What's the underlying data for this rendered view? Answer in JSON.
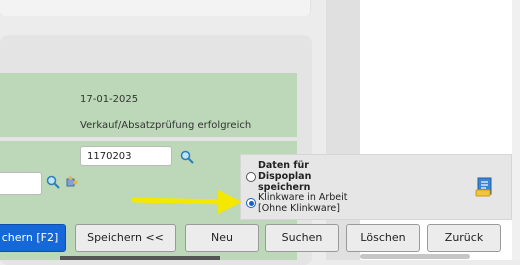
{
  "record": {
    "date": "17-01-2025",
    "status": "Verkauf/Absatzprüfung erfolgreich",
    "id_value": "1170203"
  },
  "options": {
    "title": "Daten für Dispoplan speichern",
    "selected_label": "Klinkware in Arbeit [Ohne Klinkware]"
  },
  "buttons": {
    "save_f2": "chern [F2]",
    "save_back": "Speichern <<",
    "new": "Neu",
    "search": "Suchen",
    "delete": "Löschen",
    "back": "Zurück"
  },
  "colors": {
    "accent": "#1667d8",
    "highlight_arrow": "#f5e800",
    "green_panel": "#bcd8b8"
  },
  "icons": [
    "search-icon",
    "search-icon",
    "puzzle-icon",
    "document-icon"
  ]
}
